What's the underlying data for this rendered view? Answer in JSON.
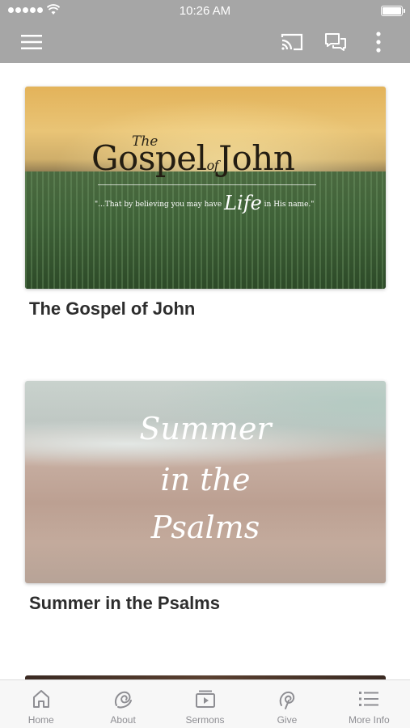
{
  "status_bar": {
    "time": "10:26 AM"
  },
  "app_bar": {
    "menu_icon": "hamburger-menu-icon",
    "actions": [
      "cast-icon",
      "chat-icon",
      "more-vertical-icon"
    ],
    "background": "#a6a6a6"
  },
  "cards": [
    {
      "title": "The Gospel of John",
      "artwork": {
        "small": "The",
        "main_left": "Gospel",
        "of": "of",
        "main_right": "John",
        "quote_before": "\"...That by believing you may have",
        "quote_life": "Life",
        "quote_after": "in His name.\""
      }
    },
    {
      "title": "Summer in the Psalms",
      "artwork": {
        "line1": "Summer",
        "line2": "in the",
        "line3": "Psalms"
      }
    }
  ],
  "tab_bar": {
    "items": [
      {
        "label": "Home",
        "icon": "home-icon"
      },
      {
        "label": "About",
        "icon": "about-swirl-icon"
      },
      {
        "label": "Sermons",
        "icon": "sermons-play-icon"
      },
      {
        "label": "Give",
        "icon": "give-swirl-icon"
      },
      {
        "label": "More Info",
        "icon": "list-icon"
      }
    ],
    "inactive_color": "#8e8e93"
  }
}
